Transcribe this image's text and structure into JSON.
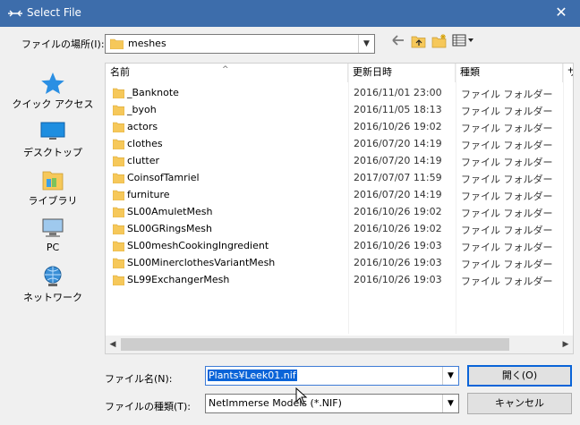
{
  "window": {
    "title": "Select File",
    "close": "✕"
  },
  "look_in": {
    "label": "ファイルの場所(I):",
    "value": "meshes"
  },
  "places": [
    {
      "label": "クイック アクセス",
      "icon": "star-icon"
    },
    {
      "label": "デスクトップ",
      "icon": "desktop-icon"
    },
    {
      "label": "ライブラリ",
      "icon": "library-icon"
    },
    {
      "label": "PC",
      "icon": "computer-icon"
    },
    {
      "label": "ネットワーク",
      "icon": "network-icon"
    }
  ],
  "columns": {
    "name": "名前",
    "date": "更新日時",
    "type": "種類",
    "size": "サ"
  },
  "files": [
    {
      "name": "_Banknote",
      "date": "2016/11/01 23:00",
      "type": "ファイル フォルダー"
    },
    {
      "name": "_byoh",
      "date": "2016/11/05 18:13",
      "type": "ファイル フォルダー"
    },
    {
      "name": "actors",
      "date": "2016/10/26 19:02",
      "type": "ファイル フォルダー"
    },
    {
      "name": "clothes",
      "date": "2016/07/20 14:19",
      "type": "ファイル フォルダー"
    },
    {
      "name": "clutter",
      "date": "2016/07/20 14:19",
      "type": "ファイル フォルダー"
    },
    {
      "name": "CoinsofTamriel",
      "date": "2017/07/07 11:59",
      "type": "ファイル フォルダー"
    },
    {
      "name": "furniture",
      "date": "2016/07/20 14:19",
      "type": "ファイル フォルダー"
    },
    {
      "name": "SL00AmuletMesh",
      "date": "2016/10/26 19:02",
      "type": "ファイル フォルダー"
    },
    {
      "name": "SL00GRingsMesh",
      "date": "2016/10/26 19:02",
      "type": "ファイル フォルダー"
    },
    {
      "name": "SL00meshCookingIngredient",
      "date": "2016/10/26 19:03",
      "type": "ファイル フォルダー"
    },
    {
      "name": "SL00MinerclothesVariantMesh",
      "date": "2016/10/26 19:03",
      "type": "ファイル フォルダー"
    },
    {
      "name": "SL99ExchangerMesh",
      "date": "2016/10/26 19:03",
      "type": "ファイル フォルダー"
    }
  ],
  "file_name": {
    "label": "ファイル名(N):",
    "value": "Plants¥Leek01.nif"
  },
  "file_type": {
    "label": "ファイルの種類(T):",
    "value": "NetImmerse Models (*.NIF)"
  },
  "buttons": {
    "open": "開く(O)",
    "cancel": "キャンセル"
  },
  "colors": {
    "titlebar": "#3d6dab",
    "folder": "#f6c85a",
    "selection": "#0a64d8"
  }
}
